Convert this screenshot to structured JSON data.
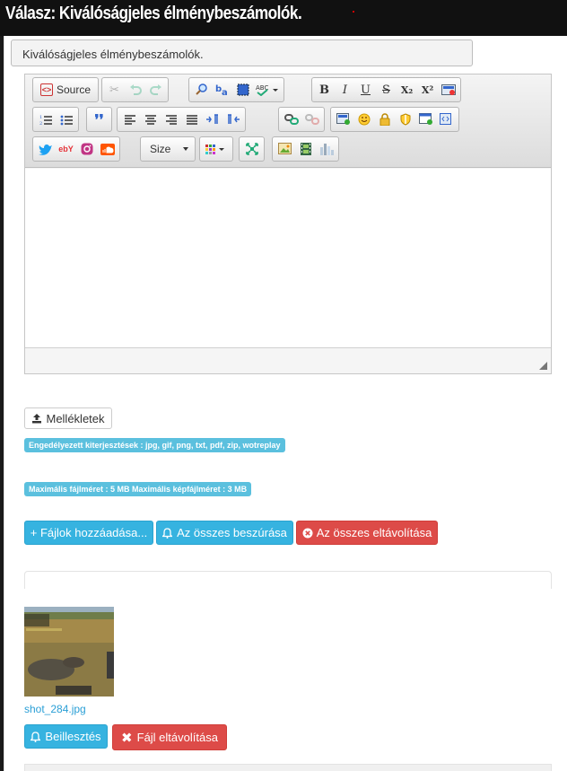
{
  "header": {
    "title": "Válasz: Kiválóságjeles élménybeszámolók."
  },
  "form": {
    "subject_value": "Kiválóságjeles élménybeszámolók."
  },
  "editor": {
    "source_label": "Source",
    "size_label": "Size",
    "tool_icons": [
      "source-icon",
      "cut-icon",
      "undo-icon",
      "redo-icon",
      "find-icon",
      "replace-icon",
      "select-all-icon",
      "spellcheck-icon",
      "bold-icon",
      "italic-icon",
      "underline-icon",
      "strike-icon",
      "subscript-icon",
      "superscript-icon",
      "youtube-icon",
      "numbered-list-icon",
      "bulleted-list-icon",
      "blockquote-icon",
      "align-left-icon",
      "align-center-icon",
      "align-right-icon",
      "justify-icon",
      "ltr-icon",
      "rtl-icon",
      "link-icon",
      "unlink-icon",
      "image-icon",
      "smiley-icon",
      "lock-icon",
      "shield-icon",
      "iframe-icon",
      "code-snippet-icon",
      "twitter-icon",
      "ebay-icon",
      "instagram-icon",
      "soundcloud-icon",
      "color-icon",
      "maximize-icon",
      "insert-image-icon",
      "film-icon",
      "chart-icon"
    ],
    "glyphs": {
      "bold": "B",
      "italic": "I",
      "underline": "U",
      "strike": "S",
      "subscript": "X₂",
      "superscript": "X²",
      "quote": "❜❜",
      "ebay": "ebY"
    },
    "colors": {
      "twitter": "#1da1f2",
      "instagram": "#c13584",
      "soundcloud": "#f50"
    }
  },
  "attachments": {
    "button_label": "Mellékletek",
    "allowed_ext": "Engedélyezett kiterjesztések : jpg, gif, png, txt, pdf, zip, wotreplay",
    "max_size": "Maximális fájlméret : 5 MB Maximális képfájlméret : 3 MB",
    "add_files": "+ Fájlok hozzáadása...",
    "insert_all": "Az összes beszúrása",
    "remove_all": "Az összes eltávolítása",
    "file": {
      "name": "shot_284.jpg",
      "insert": "Beillesztés",
      "remove": "Fájl eltávolítása"
    }
  },
  "colors": {
    "info": "#36b3e0",
    "danger": "#dd4b48",
    "link": "#2a9fd6"
  }
}
